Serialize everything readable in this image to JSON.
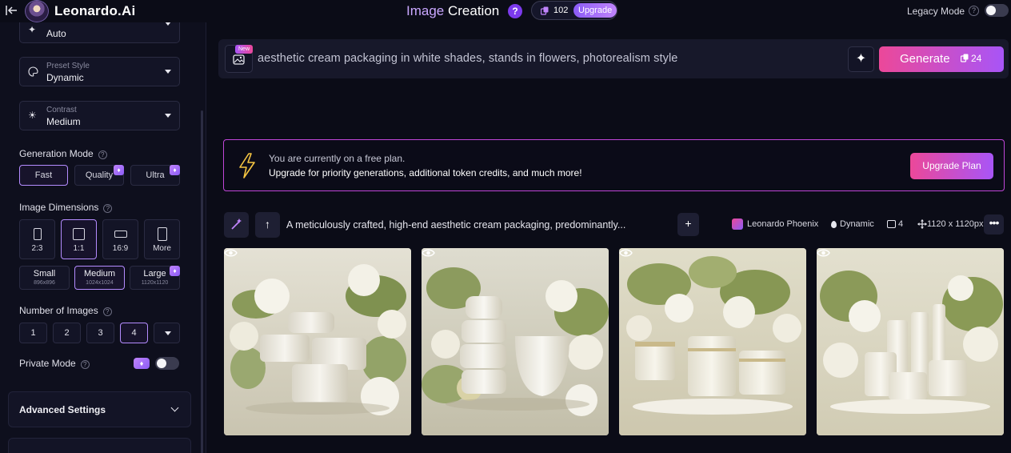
{
  "topbar": {
    "app_name": "Leonardo.Ai",
    "title_part1": "Image",
    "title_part2": "Creation",
    "help_icon": "?",
    "token_count": "102",
    "upgrade_label": "Upgrade",
    "legacy_mode_label": "Legacy Mode",
    "legacy_help": "?"
  },
  "sidebar": {
    "top_select_value": "Auto",
    "preset_style": {
      "caption": "Preset Style",
      "value": "Dynamic"
    },
    "contrast": {
      "caption": "Contrast",
      "value": "Medium"
    },
    "generation_mode": {
      "label": "Generation Mode",
      "options": [
        "Fast",
        "Quality",
        "Ultra"
      ],
      "selected": "Fast"
    },
    "image_dimensions": {
      "label": "Image Dimensions",
      "ratios": [
        "2:3",
        "1:1",
        "16:9",
        "More"
      ],
      "selected_ratio": "1:1",
      "sizes": [
        {
          "name": "Small",
          "dims": "896x896"
        },
        {
          "name": "Medium",
          "dims": "1024x1024"
        },
        {
          "name": "Large",
          "dims": "1120x1120"
        }
      ],
      "selected_size": "Medium"
    },
    "number_of_images": {
      "label": "Number of Images",
      "options": [
        "1",
        "2",
        "3",
        "4"
      ],
      "selected": "4"
    },
    "private_mode_label": "Private Mode",
    "advanced_settings_label": "Advanced Settings"
  },
  "prompt": {
    "new_badge": "New",
    "text": "aesthetic cream packaging in white shades, stands in flowers, photorealism style",
    "generate_label": "Generate",
    "generate_cost": "24"
  },
  "banner": {
    "line1": "You are currently on a free plan.",
    "line2": "Upgrade for priority generations, additional token credits, and much more!",
    "button_label": "Upgrade Plan"
  },
  "generation": {
    "prompt_preview": "A meticulously crafted, high-end aesthetic cream packaging, predominantly...",
    "model": "Leonardo Phoenix",
    "style": "Dynamic",
    "count": "4",
    "dimensions": "1120 x 1120px"
  },
  "colors": {
    "accent_purple": "#a855f7",
    "accent_pink": "#ec4899",
    "background": "#0b0c17",
    "selected_border": "#b48cff"
  }
}
